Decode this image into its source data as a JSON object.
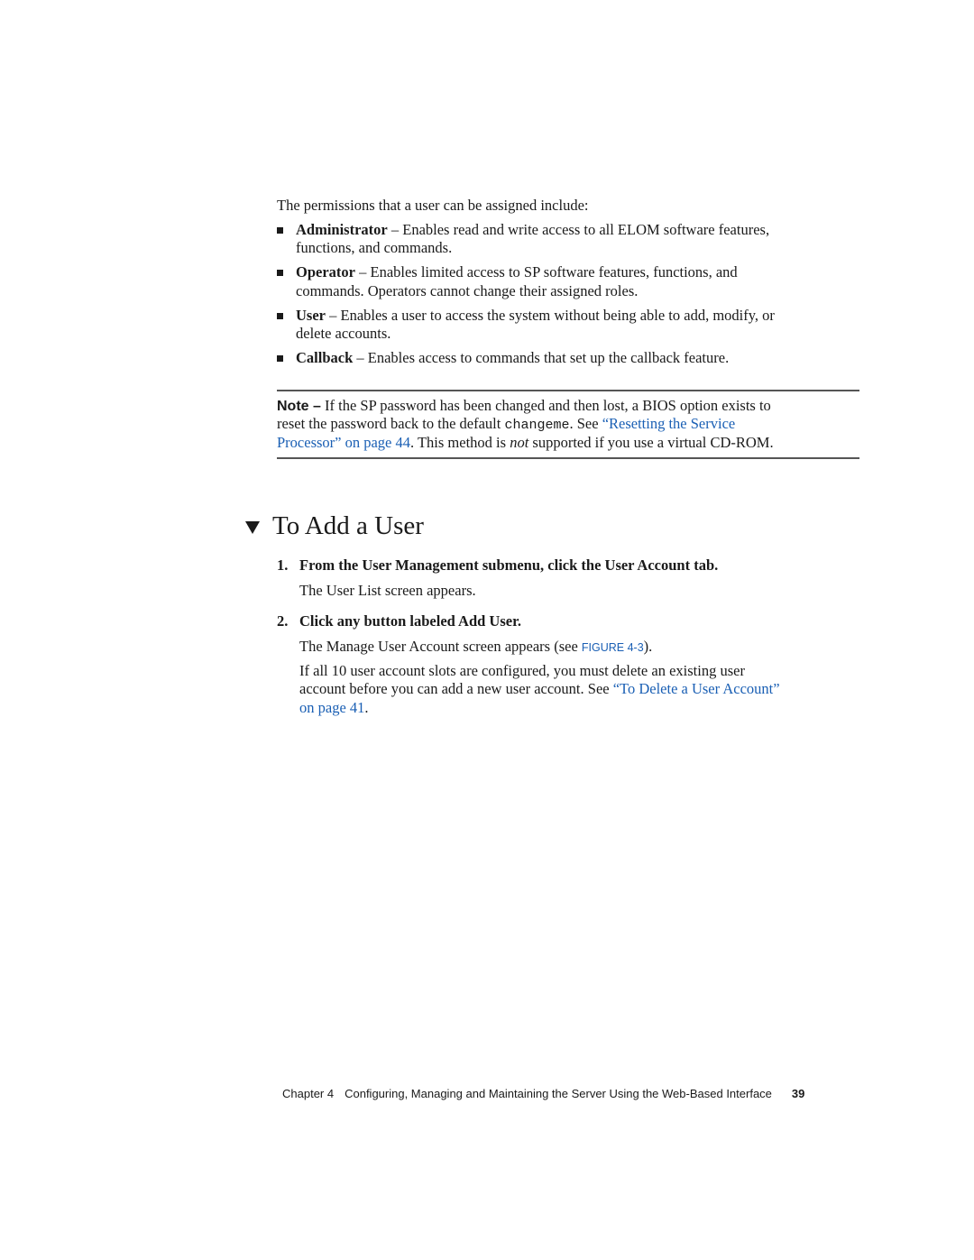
{
  "intro": "The permissions that a user can be assigned include:",
  "permissions": [
    {
      "name": "Administrator",
      "desc_line1": " – Enables read and write access to all ELOM software features,",
      "desc_line2": "functions, and commands."
    },
    {
      "name": "Operator",
      "desc_line1": " – Enables limited access to SP software features, functions, and",
      "desc_line2": "commands. Operators cannot change their assigned roles."
    },
    {
      "name": "User",
      "desc_line1": " – Enables a user to access the system without being able to add, modify, or",
      "desc_line2": "delete accounts."
    },
    {
      "name": "Callback",
      "desc_line1": " – Enables access to commands that set up the callback feature.",
      "desc_line2": ""
    }
  ],
  "note": {
    "label": "Note –",
    "line1": " If the SP password has been changed and then lost, a BIOS option exists to",
    "line2_pre": "reset the password back to the default ",
    "code": "changeme",
    "line2_mid": ". See ",
    "link_part1": "“Resetting the Service",
    "link_part2": "Processor” on page 44",
    "line3_mid": ". This method is ",
    "emphasis": "not",
    "line3_post": " supported if you use a virtual CD-ROM."
  },
  "section": {
    "marker_icon": "down-triangle",
    "title": "To Add a User"
  },
  "steps": [
    {
      "number": "1.",
      "instruction": "From the User Management submenu, click the User Account tab.",
      "result": "The User List screen appears."
    },
    {
      "number": "2.",
      "instruction": "Click any button labeled Add User.",
      "result_pre": "The Manage User Account screen appears (see ",
      "figure_ref": "FIGURE 4-3",
      "result_post": ").",
      "extra_line1": "If all 10 user account slots are configured, you must delete an existing user",
      "extra_line2_pre": "account before you can add a new user account. See ",
      "extra_link1": "“To Delete a User Account”",
      "extra_link2": "on page 41",
      "extra_post": "."
    }
  ],
  "footer": {
    "chapter": "Chapter 4",
    "title": "Configuring, Managing and Maintaining the Server Using the Web-Based Interface",
    "page": "39"
  },
  "colors": {
    "link": "#1a5fb4",
    "text": "#1a1a1a",
    "rule": "#555555"
  }
}
